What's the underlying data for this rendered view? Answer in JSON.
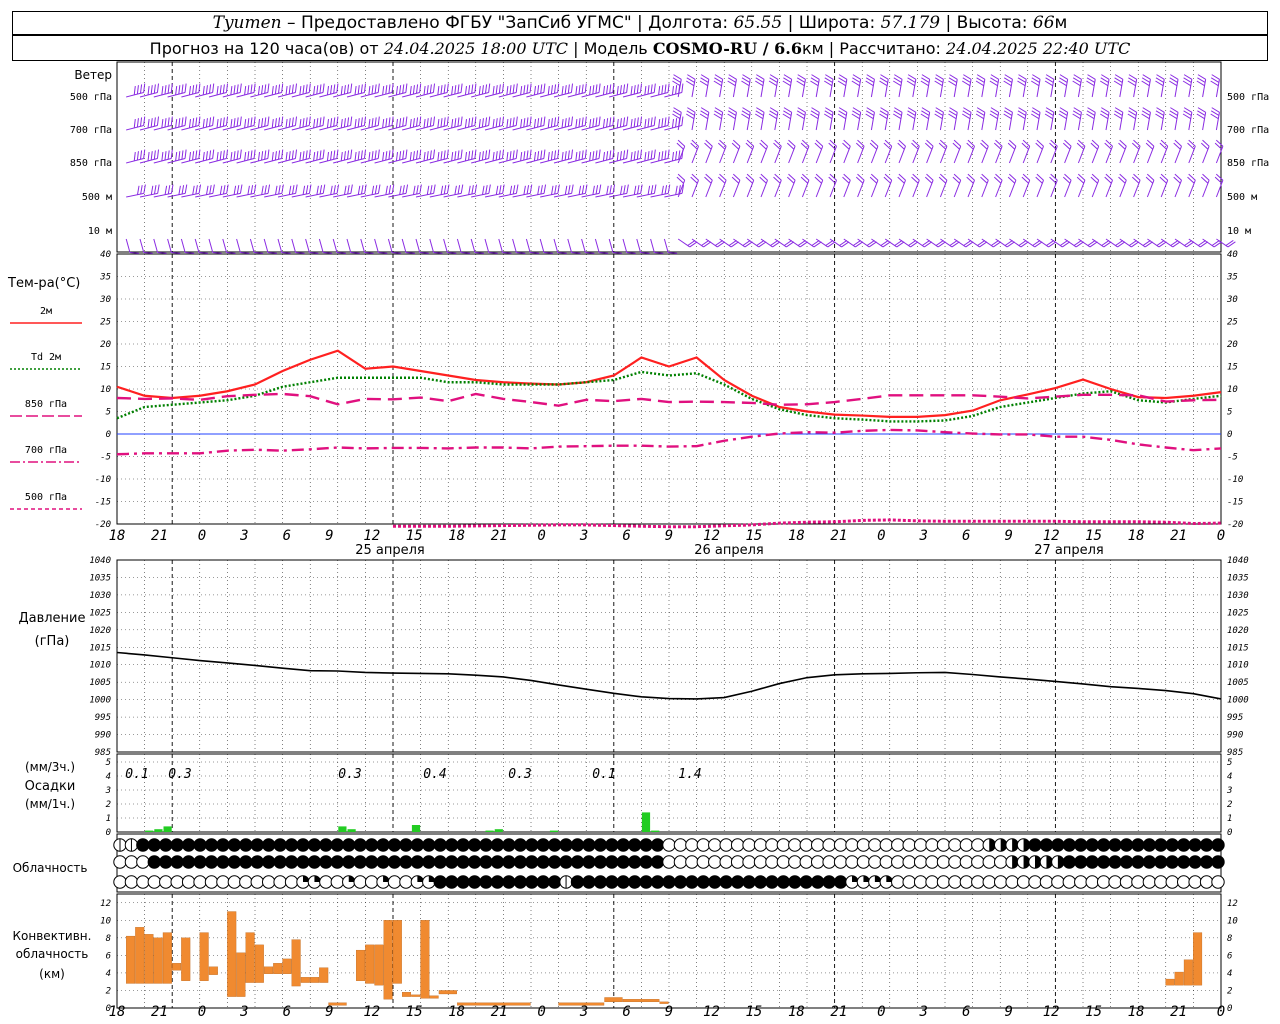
{
  "header": {
    "station_prefix": "Tyumen",
    "line1_mid": " – Предоставлено ФГБУ \"ЗапСиб УГМС\" | Долгота: ",
    "longitude": "65.55",
    "lat_label": " | Широта: ",
    "latitude": "57.179",
    "alt_label": " | Высота: ",
    "altitude": "66",
    "alt_unit": "м",
    "forecast_label": "Прогноз на 120 часа(ов) от ",
    "forecast_start": "24.04.2025 18:00 UTC",
    "model_label": " | Модель ",
    "model_name": "COSMO-RU / 6.6",
    "model_unit": "км",
    "calc_label": " | Рассчитано: ",
    "calc_time": "24.04.2025 22:40 UTC"
  },
  "wind_panel": {
    "title": "Ветер",
    "levels": [
      "500 гПа",
      "700 гПа",
      "850 гПа",
      "500 м",
      "10 м"
    ],
    "barb_color": "#8a2be2"
  },
  "temp_panel": {
    "title": "Тем-ра(°С)",
    "legend": [
      {
        "label": "2м",
        "color": "#ff2020",
        "dash": "solid"
      },
      {
        "label": "Td  2м",
        "color": "#008000",
        "dash": "dotted"
      },
      {
        "label": "850 гПа",
        "color": "#e0107f",
        "dash": "long-dash"
      },
      {
        "label": "700 гПа",
        "color": "#e0107f",
        "dash": "dash-dot"
      },
      {
        "label": "500 гПа",
        "color": "#e0107f",
        "dash": "short-dash"
      }
    ],
    "yticks": [
      "40",
      "35",
      "30",
      "25",
      "20",
      "15",
      "10",
      "5",
      "0",
      "-5",
      "-10",
      "-15",
      "-20"
    ]
  },
  "pressure_panel": {
    "title": "Давление",
    "unit": "(гПа)",
    "yticks": [
      "1040",
      "1035",
      "1030",
      "1025",
      "1020",
      "1015",
      "1010",
      "1005",
      "1000",
      "995",
      "990",
      "985"
    ]
  },
  "precip_panel": {
    "unit_3h": "(мм/3ч.)",
    "title": "Осадки",
    "unit_1h": "(мм/1ч.)",
    "yticks": [
      "5",
      "4",
      "3",
      "2",
      "1",
      "0"
    ],
    "totals_3h": [
      {
        "hour": 21,
        "text": "0.1"
      },
      {
        "hour": 24,
        "text": "0.3"
      },
      {
        "hour": 36,
        "text": "0.3"
      },
      {
        "hour": 42,
        "text": "0.4"
      },
      {
        "hour": 48,
        "text": "0.3"
      },
      {
        "hour": 54,
        "text": "0.1"
      },
      {
        "hour": 60,
        "text": "1.4"
      }
    ]
  },
  "cloud_panel": {
    "title": "Облачность"
  },
  "conv_panel": {
    "title_line1": "Конвективн.",
    "title_line2": "облачность",
    "unit": "(км)",
    "yticks": [
      "12",
      "10",
      "8",
      "6",
      "4",
      "2",
      "0"
    ],
    "bar_color": "#f08a30"
  },
  "time_axis": {
    "tick_labels": [
      "18",
      "21",
      "0",
      "3",
      "6",
      "9",
      "12",
      "15",
      "18",
      "21",
      "0",
      "3",
      "6",
      "9",
      "12",
      "15",
      "18",
      "21",
      "0",
      "3",
      "6",
      "9",
      "12",
      "15",
      "18",
      "21",
      "0"
    ],
    "day_labels": [
      {
        "hour": 39,
        "text": "25 апреля"
      },
      {
        "hour": 63,
        "text": "26 апреля"
      },
      {
        "hour": 111,
        "text": "27 апреля"
      }
    ]
  },
  "chart_data": [
    {
      "type": "line",
      "title": "Тем-ра(°С)",
      "x_unit": "hours from 24.04.2025 18:00 UTC",
      "ylim": [
        -20,
        40
      ],
      "series": [
        {
          "name": "2м",
          "x": [
            0,
            3,
            6,
            9,
            12,
            15,
            18,
            21,
            24,
            27,
            30,
            33,
            36,
            39,
            42,
            45,
            48,
            51,
            54,
            57,
            60,
            63,
            66,
            69,
            72,
            75,
            78,
            81,
            84,
            87,
            90,
            93,
            96,
            99,
            102,
            105,
            108,
            111,
            114,
            117,
            120
          ],
          "values": [
            10.5,
            8.5,
            8.0,
            8.5,
            9.5,
            11,
            14,
            16.5,
            18.5,
            14.5,
            15,
            14,
            13,
            12,
            11.5,
            11.2,
            11,
            11.5,
            13,
            17,
            15,
            17,
            12,
            8.5,
            6,
            5,
            4.3,
            4.1,
            3.8,
            3.8,
            4.2,
            5.2,
            7.5,
            8.8,
            10.2,
            12.1,
            10,
            8.2,
            8.0,
            8.5,
            9.3
          ]
        },
        {
          "name": "Td  2м",
          "x": [
            0,
            3,
            6,
            9,
            12,
            15,
            18,
            21,
            24,
            27,
            30,
            33,
            36,
            39,
            42,
            45,
            48,
            51,
            54,
            57,
            60,
            63,
            66,
            69,
            72,
            75,
            78,
            81,
            84,
            87,
            90,
            93,
            96,
            99,
            102,
            105,
            108,
            111,
            114,
            117,
            120
          ],
          "values": [
            3.5,
            6.0,
            6.5,
            7.0,
            7.5,
            8.5,
            10.5,
            11.5,
            12.5,
            12.5,
            12.5,
            12.5,
            11.5,
            11.5,
            11.0,
            11.0,
            11.0,
            11.5,
            12.0,
            13.8,
            13.0,
            13.5,
            11.0,
            7.8,
            5.5,
            4.2,
            3.5,
            3.2,
            2.8,
            2.8,
            3.0,
            4.0,
            6.0,
            7.0,
            8.0,
            9.0,
            9.5,
            7.5,
            7.0,
            7.8,
            8.5
          ]
        },
        {
          "name": "850 гПа",
          "x": [
            0,
            3,
            6,
            9,
            12,
            15,
            18,
            21,
            24,
            27,
            30,
            33,
            36,
            39,
            42,
            45,
            48,
            51,
            54,
            57,
            60,
            63,
            66,
            69,
            72,
            75,
            78,
            81,
            84,
            87,
            90,
            93,
            96,
            99,
            102,
            105,
            108,
            111,
            114,
            117,
            120
          ],
          "values": [
            8.0,
            7.8,
            7.9,
            7.6,
            8.4,
            8.7,
            8.9,
            8.4,
            6.6,
            7.8,
            7.7,
            8.1,
            7.3,
            8.9,
            7.8,
            7.1,
            6.3,
            7.6,
            7.3,
            7.8,
            7.1,
            7.2,
            7.1,
            6.9,
            6.5,
            6.6,
            7.1,
            7.8,
            8.6,
            8.6,
            8.6,
            8.6,
            8.3,
            7.9,
            8.3,
            8.7,
            8.7,
            8.6,
            7.2,
            7.5,
            7.6
          ]
        },
        {
          "name": "700 гПа",
          "x": [
            0,
            3,
            6,
            9,
            12,
            15,
            18,
            21,
            24,
            27,
            30,
            33,
            36,
            39,
            42,
            45,
            48,
            51,
            54,
            57,
            60,
            63,
            66,
            69,
            72,
            75,
            78,
            81,
            84,
            87,
            90,
            93,
            96,
            99,
            102,
            105,
            108,
            111,
            114,
            117,
            120
          ],
          "values": [
            -4.5,
            -4.3,
            -4.3,
            -4.3,
            -3.7,
            -3.5,
            -3.7,
            -3.4,
            -3.0,
            -3.2,
            -3.1,
            -3.1,
            -3.2,
            -3.0,
            -3.0,
            -3.2,
            -2.8,
            -2.7,
            -2.6,
            -2.6,
            -2.8,
            -2.7,
            -1.5,
            -0.6,
            0.1,
            0.4,
            0.3,
            0.7,
            0.9,
            0.8,
            0.4,
            0.1,
            -0.1,
            -0.1,
            -0.6,
            -0.6,
            -1.3,
            -2.3,
            -3.0,
            -3.6,
            -3.2
          ]
        },
        {
          "name": "500 гПа",
          "x": [
            30,
            36,
            48,
            51,
            57,
            60,
            63,
            66,
            69,
            72,
            75,
            78,
            81,
            84,
            87,
            90,
            93,
            96,
            99,
            102,
            105,
            108,
            111,
            114,
            117,
            120
          ],
          "values": [
            -20.5,
            -20.5,
            -20.2,
            -20.2,
            -20.5,
            -20.6,
            -20.6,
            -20.4,
            -20.2,
            -19.8,
            -19.6,
            -19.5,
            -19.2,
            -19.1,
            -19.3,
            -19.4,
            -19.4,
            -19.4,
            -19.4,
            -19.4,
            -19.5,
            -19.5,
            -19.5,
            -19.6,
            -19.9,
            -19.8
          ]
        }
      ]
    },
    {
      "type": "line",
      "title": "Давление",
      "ylabel": "(гПа)",
      "x_unit": "hours from 24.04.2025 18:00 UTC",
      "ylim": [
        985,
        1040
      ],
      "series": [
        {
          "name": "Давление",
          "x": [
            0,
            3,
            6,
            9,
            12,
            15,
            18,
            21,
            24,
            27,
            30,
            33,
            36,
            39,
            42,
            45,
            48,
            51,
            54,
            57,
            60,
            63,
            66,
            69,
            72,
            75,
            78,
            81,
            84,
            87,
            90,
            93,
            96,
            99,
            102,
            105,
            108,
            111,
            114,
            117,
            120
          ],
          "values": [
            1013.5,
            1012.8,
            1012.0,
            1011.2,
            1010.5,
            1009.8,
            1009.0,
            1008.3,
            1008.2,
            1007.8,
            1007.6,
            1007.5,
            1007.4,
            1007.0,
            1006.5,
            1005.5,
            1004.2,
            1003.0,
            1001.8,
            1000.8,
            1000.3,
            1000.2,
            1000.6,
            1002.4,
            1004.6,
            1006.3,
            1007.1,
            1007.4,
            1007.5,
            1007.7,
            1007.8,
            1007.2,
            1006.5,
            1005.9,
            1005.2,
            1004.5,
            1003.7,
            1003.2,
            1002.6,
            1001.7,
            1000.2
          ]
        }
      ]
    },
    {
      "type": "bar",
      "title": "Осадки",
      "ylabel": "(мм/1ч.)",
      "x_unit": "hours from 24.04.2025 18:00 UTC",
      "ylim": [
        0,
        5
      ],
      "bars": [
        {
          "x": 3,
          "value": 0.1
        },
        {
          "x": 4,
          "value": 0.2
        },
        {
          "x": 5,
          "value": 0.4
        },
        {
          "x": 24,
          "value": 0.4
        },
        {
          "x": 25,
          "value": 0.2
        },
        {
          "x": 32,
          "value": 0.5
        },
        {
          "x": 40,
          "value": 0.1
        },
        {
          "x": 41,
          "value": 0.2
        },
        {
          "x": 47,
          "value": 0.1
        },
        {
          "x": 57,
          "value": 1.4
        },
        {
          "x": 58,
          "value": 0.1
        }
      ],
      "color": "#22cc22"
    },
    {
      "type": "bar",
      "title": "Конвективн. облачность",
      "ylabel": "(км)",
      "x_unit": "hours from 24.04.2025 18:00 UTC",
      "ylim": [
        0,
        13
      ],
      "bars": [
        {
          "x0": 1,
          "x1": 2,
          "bottom": 2.8,
          "top": 8.2
        },
        {
          "x0": 2,
          "x1": 3,
          "bottom": 2.8,
          "top": 9.2
        },
        {
          "x0": 3,
          "x1": 4,
          "bottom": 2.8,
          "top": 8.4
        },
        {
          "x0": 4,
          "x1": 5,
          "bottom": 2.8,
          "top": 8.0
        },
        {
          "x0": 5,
          "x1": 6,
          "bottom": 2.8,
          "top": 8.6
        },
        {
          "x0": 6,
          "x1": 7,
          "bottom": 4.3,
          "top": 5.1
        },
        {
          "x0": 7,
          "x1": 8,
          "bottom": 3.1,
          "top": 8.0
        },
        {
          "x0": 9,
          "x1": 10,
          "bottom": 3.1,
          "top": 8.6
        },
        {
          "x0": 10,
          "x1": 11,
          "bottom": 3.8,
          "top": 4.7
        },
        {
          "x0": 12,
          "x1": 13,
          "bottom": 1.3,
          "top": 11.0
        },
        {
          "x0": 13,
          "x1": 14,
          "bottom": 1.3,
          "top": 6.3
        },
        {
          "x0": 14,
          "x1": 15,
          "bottom": 2.9,
          "top": 8.6
        },
        {
          "x0": 15,
          "x1": 16,
          "bottom": 2.9,
          "top": 7.2
        },
        {
          "x0": 16,
          "x1": 17,
          "bottom": 3.9,
          "top": 4.7
        },
        {
          "x0": 17,
          "x1": 18,
          "bottom": 3.9,
          "top": 5.1
        },
        {
          "x0": 18,
          "x1": 19,
          "bottom": 3.9,
          "top": 5.6
        },
        {
          "x0": 19,
          "x1": 20,
          "bottom": 2.5,
          "top": 7.8
        },
        {
          "x0": 20,
          "x1": 21,
          "bottom": 2.9,
          "top": 3.5
        },
        {
          "x0": 21,
          "x1": 22,
          "bottom": 2.9,
          "top": 3.5
        },
        {
          "x0": 22,
          "x1": 23,
          "bottom": 2.9,
          "top": 4.6
        },
        {
          "x0": 23,
          "x1": 25,
          "bottom": 0.3,
          "top": 0.6
        },
        {
          "x0": 26,
          "x1": 27,
          "bottom": 3.1,
          "top": 6.6
        },
        {
          "x0": 27,
          "x1": 28,
          "bottom": 2.8,
          "top": 7.2
        },
        {
          "x0": 28,
          "x1": 29,
          "bottom": 2.6,
          "top": 7.2
        },
        {
          "x0": 29,
          "x1": 30,
          "bottom": 1.0,
          "top": 10.0
        },
        {
          "x0": 30,
          "x1": 31,
          "bottom": 2.8,
          "top": 10.0
        },
        {
          "x0": 31,
          "x1": 32,
          "bottom": 1.3,
          "top": 1.8
        },
        {
          "x0": 32,
          "x1": 33,
          "bottom": 1.3,
          "top": 1.5
        },
        {
          "x0": 33,
          "x1": 34,
          "bottom": 1.1,
          "top": 10.0
        },
        {
          "x0": 34,
          "x1": 35,
          "bottom": 1.1,
          "top": 1.4
        },
        {
          "x0": 35,
          "x1": 37,
          "bottom": 1.6,
          "top": 2.0
        },
        {
          "x0": 37,
          "x1": 45,
          "bottom": 0.3,
          "top": 0.6
        },
        {
          "x0": 48,
          "x1": 53,
          "bottom": 0.3,
          "top": 0.6
        },
        {
          "x0": 53,
          "x1": 55,
          "bottom": 0.7,
          "top": 1.2
        },
        {
          "x0": 55,
          "x1": 59,
          "bottom": 0.7,
          "top": 1.0
        },
        {
          "x0": 59,
          "x1": 60,
          "bottom": 0.5,
          "top": 0.7
        },
        {
          "x0": 59,
          "x1": 60,
          "bottom": 0,
          "top": 0
        },
        {
          "x0": 114,
          "x1": 115,
          "bottom": 2.6,
          "top": 3.3
        },
        {
          "x0": 115,
          "x1": 116,
          "bottom": 2.6,
          "top": 4.1
        },
        {
          "x0": 116,
          "x1": 117,
          "bottom": 2.6,
          "top": 5.5
        },
        {
          "x0": 117,
          "x1": 118,
          "bottom": 2.6,
          "top": 8.6
        }
      ]
    }
  ]
}
